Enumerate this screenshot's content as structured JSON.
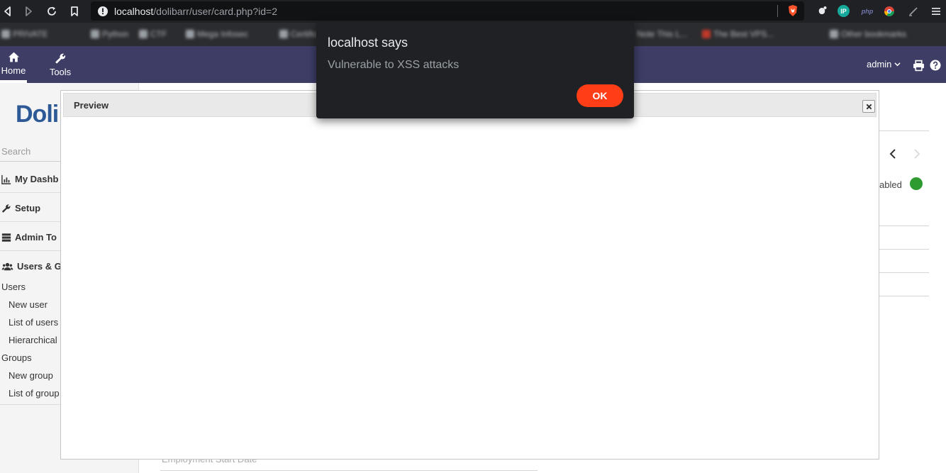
{
  "browser": {
    "url_host": "localhost",
    "url_path": "/dolibarr/user/card.php?id=2",
    "bookmarks": [
      "PRIVATE",
      "Python",
      "CTF",
      "Mega Infosec",
      "Certificat",
      "Note This L...",
      "The Best VPS...",
      "Other bookmarks"
    ],
    "extensions": [
      "gnome-extension-icon",
      "ip-extension-icon",
      "php-extension-icon",
      "chrome-extension-icon",
      "pen-extension-icon"
    ]
  },
  "topbar": {
    "home_label": "Home",
    "tools_label": "Tools",
    "user_label": "admin",
    "accent_color": "#3d3d66"
  },
  "sidebar": {
    "logo_text": "Doli",
    "search_placeholder": "Search",
    "sections": [
      {
        "label": "My Dashb",
        "icon": "chart-icon"
      },
      {
        "label": "Setup",
        "icon": "wrench-icon"
      },
      {
        "label": "Admin To",
        "icon": "server-icon"
      },
      {
        "label": "Users & G",
        "icon": "users-icon"
      }
    ],
    "items": {
      "users": "Users",
      "new_user": "New user",
      "list_users": "List of users",
      "hierarchical": "Hierarchical",
      "groups": "Groups",
      "new_group": "New group",
      "list_groups": "List of group"
    }
  },
  "main": {
    "status_text": "abled",
    "status_color": "#2e9b31",
    "hidden_field_label": "Employment Start Date"
  },
  "modal": {
    "title": "Preview"
  },
  "alert": {
    "title": "localhost says",
    "message": "Vulnerable to XSS attacks",
    "ok_label": "OK",
    "ok_color": "#ff3d17"
  }
}
